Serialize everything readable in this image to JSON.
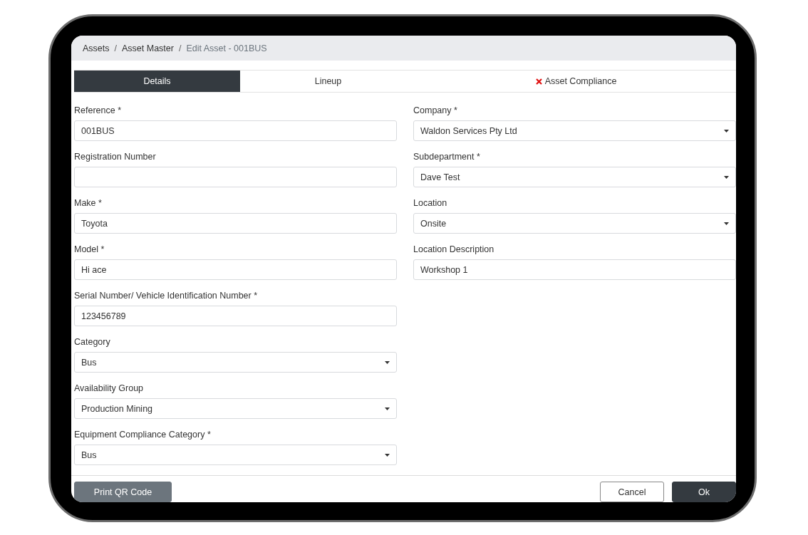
{
  "breadcrumb": [
    {
      "label": "Assets",
      "current": false
    },
    {
      "label": "Asset Master",
      "current": false,
      "separator": "/"
    },
    {
      "label": "Edit Asset - 001BUS",
      "current": true,
      "separator": "/"
    }
  ],
  "tabs": [
    {
      "label": "Details",
      "selected": true,
      "error": false
    },
    {
      "label": "Lineup",
      "selected": false,
      "error": false
    },
    {
      "label": "Asset Compliance",
      "selected": false,
      "error": true
    }
  ],
  "left_fields": [
    {
      "label": "Reference *",
      "value": "001BUS",
      "kind": "text"
    },
    {
      "label": "Registration Number",
      "kind": "text"
    },
    {
      "label": "Make *",
      "value": "Toyota",
      "kind": "text"
    },
    {
      "label": "Model *",
      "value": "Hi ace",
      "kind": "text"
    },
    {
      "label": "Serial Number/ Vehicle Identification Number *",
      "value": "123456789",
      "kind": "text"
    },
    {
      "label": "Category",
      "value": "Bus",
      "kind": "select"
    },
    {
      "label": "Availability Group",
      "value": "Production Mining",
      "kind": "select"
    },
    {
      "label": "Equipment Compliance Category *",
      "value": "Bus",
      "kind": "select"
    }
  ],
  "right_fields": [
    {
      "label": "Company *",
      "value": "Waldon Services Pty Ltd",
      "kind": "select"
    },
    {
      "label": "Subdepartment *",
      "value": "Dave Test",
      "kind": "select"
    },
    {
      "label": "Location",
      "value": "Onsite",
      "kind": "select"
    },
    {
      "label": "Location Description",
      "value": "Workshop 1",
      "kind": "text"
    }
  ],
  "footer": {
    "left_buttons": [
      {
        "label": "Print QR Code",
        "kind": "secondary"
      }
    ],
    "right_buttons": [
      {
        "label": "Cancel",
        "kind": "outline"
      },
      {
        "label": "Ok",
        "kind": "primary"
      }
    ]
  }
}
